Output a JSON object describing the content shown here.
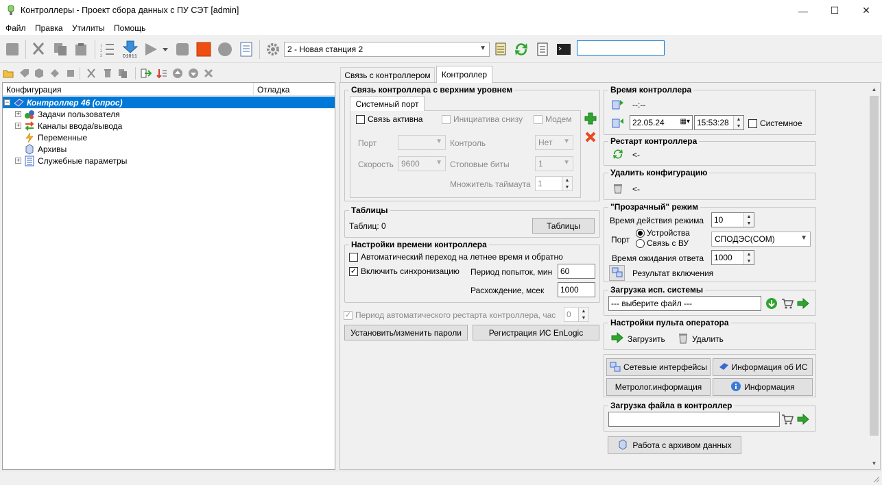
{
  "window": {
    "title": "Контроллеры - Проект сбора данных с ПУ СЭТ [admin]",
    "minimize": "—",
    "maximize": "☐",
    "close": "✕"
  },
  "menu": [
    "Файл",
    "Правка",
    "Утилиты",
    "Помощь"
  ],
  "toolbar": {
    "station_combo": "2 - Новая станция 2",
    "search_value": ""
  },
  "tree": {
    "col_config": "Конфигурация",
    "col_debug": "Отладка",
    "root": "Контроллер 46 (опрос)",
    "items": [
      "Задачи пользователя",
      "Каналы ввода/вывода",
      "Переменные",
      "Архивы",
      "Служебные параметры"
    ]
  },
  "tabs": [
    "Связь с контроллером",
    "Контроллер"
  ],
  "uplink": {
    "title": "Связь контроллера с верхним уровнем",
    "subtab": "Системный порт",
    "link_active": "Связь активна",
    "initiative": "Инициатива снизу",
    "modem": "Модем",
    "port_label": "Порт",
    "port_value": "",
    "control_label": "Контроль",
    "control_value": "Нет",
    "speed_label": "Скорость",
    "speed_value": "9600",
    "stopbits_label": "Стоповые биты",
    "stopbits_value": "1",
    "timeout_label": "Множитель таймаута",
    "timeout_value": "1"
  },
  "tables": {
    "title": "Таблицы",
    "count": "Таблиц: 0",
    "button": "Таблицы"
  },
  "timeset": {
    "title": "Настройки времени контроллера",
    "dst": "Автоматический переход на летнее время и обратно",
    "sync": "Включить синхронизацию",
    "period_label": "Период попыток, мин",
    "period_value": "60",
    "diff_label": "Расхождение, мсек",
    "diff_value": "1000"
  },
  "restart_period": {
    "label": "Период автоматического рестарта контроллера, час",
    "value": "0"
  },
  "buttons": {
    "passwords": "Установить/изменить пароли",
    "registration": "Регистрация ИС EnLogic"
  },
  "ctime": {
    "title": "Время контроллера",
    "current": "--:--",
    "date": "22.05.24",
    "time": "15:53:28",
    "system": "Системное"
  },
  "restart": {
    "title": "Рестарт контроллера",
    "status": "<-"
  },
  "delete_config": {
    "title": "Удалить конфигурацию",
    "status": "<-"
  },
  "transparent": {
    "title": "\"Прозрачный\" режим",
    "duration_label": "Время действия режима",
    "duration_value": "10",
    "port_label": "Порт",
    "radio_devices": "Устройства",
    "radio_link": "Связь с ВУ",
    "port_value": "СПОДЭС(COM)",
    "wait_label": "Время ожидания ответа",
    "wait_value": "1000",
    "result_label": "Результат включения"
  },
  "sysload": {
    "title": "Загрузка исп. системы",
    "file_value": "--- выберите файл ---"
  },
  "panel": {
    "title": "Настройки пульта оператора",
    "load": "Загрузить",
    "delete": "Удалить"
  },
  "info_buttons": {
    "net": "Сетевые интерфейсы",
    "is_info": "Информация об ИС",
    "metrology": "Метролог.информация",
    "info": "Информация"
  },
  "fileload": {
    "title": "Загрузка файла в контроллер",
    "file_value": ""
  },
  "archive_button": "Работа с архивом данных",
  "colors": {
    "selection": "#0078d7",
    "window_bg": "#f0f0f0",
    "green": "#2ea52e",
    "red": "#e8491e"
  }
}
